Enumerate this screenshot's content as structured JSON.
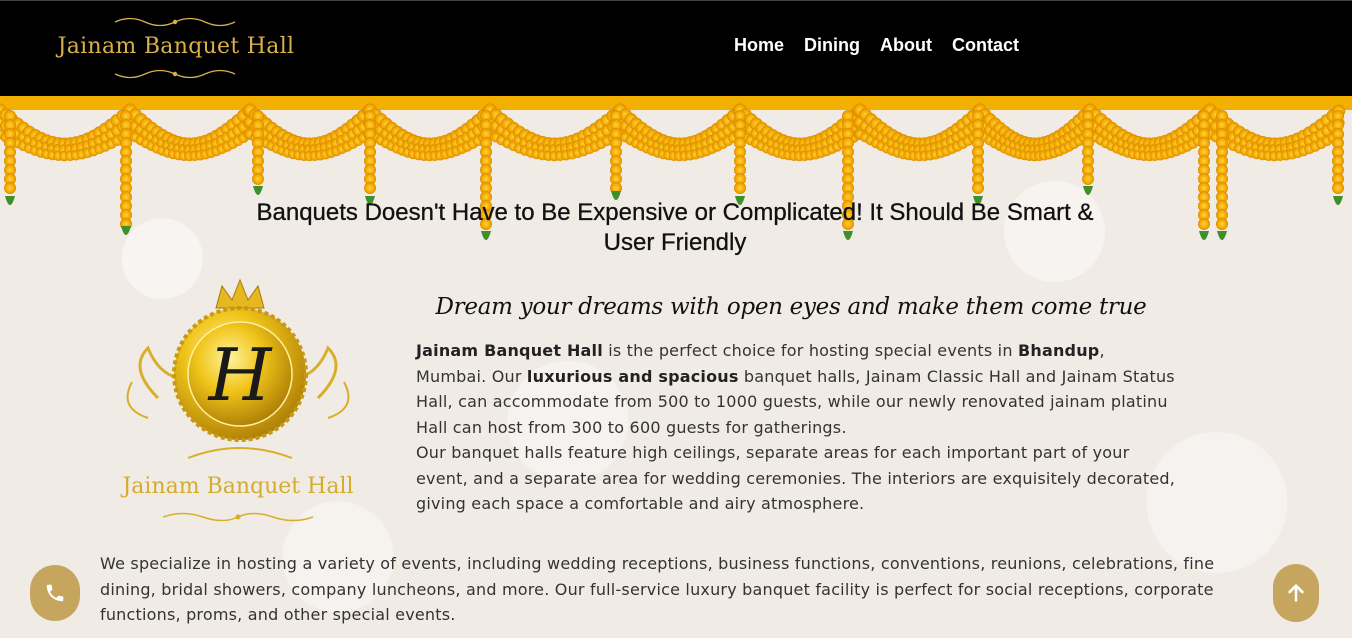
{
  "header": {
    "logo_text": "Jainam Banquet Hall",
    "nav": [
      {
        "label": "Home"
      },
      {
        "label": "Dining"
      },
      {
        "label": "About"
      },
      {
        "label": "Contact"
      }
    ]
  },
  "hero": {
    "headline": "Banquets Doesn't Have to Be Expensive or Complicated! It Should Be Smart & User Friendly"
  },
  "about": {
    "emblem_letter": "H",
    "emblem_text": "Jainam Banquet Hall",
    "tagline": "Dream your dreams with open eyes and make them come true",
    "intro": {
      "s1_bold": "Jainam Banquet Hall",
      "s1": " is the perfect choice for hosting special events in ",
      "s2_bold": "Bhandup",
      "s2": ", Mumbai. Our ",
      "s3_bold": "luxurious and spacious",
      "s3": " banquet halls, Jainam Classic Hall and Jainam Status Hall, can accommodate from 500 to 1000 guests, while our newly renovated jainam platinu Hall can host from 300 to 600 guests for gatherings.",
      "p2": "Our banquet halls feature high ceilings, separate areas for each important part of your event, and a separate area for wedding ceremonies. The interiors are exquisitely decorated, giving each space a comfortable and airy atmosphere."
    },
    "services": "We specialize in hosting a variety of events, including wedding receptions, business functions, conventions, reunions, celebrations, fine dining, bridal showers, company luncheons, and more. Our full-service luxury banquet facility is perfect for social receptions, corporate functions, proms, and other special events."
  },
  "floating": {
    "call_icon": "phone-icon",
    "top_icon": "arrow-up-icon"
  },
  "colors": {
    "header_bg": "#000000",
    "gold": "#d9b04a",
    "marigold": "#f7b800",
    "fab": "#c6a55e",
    "page_bg": "#f1ebe6"
  }
}
